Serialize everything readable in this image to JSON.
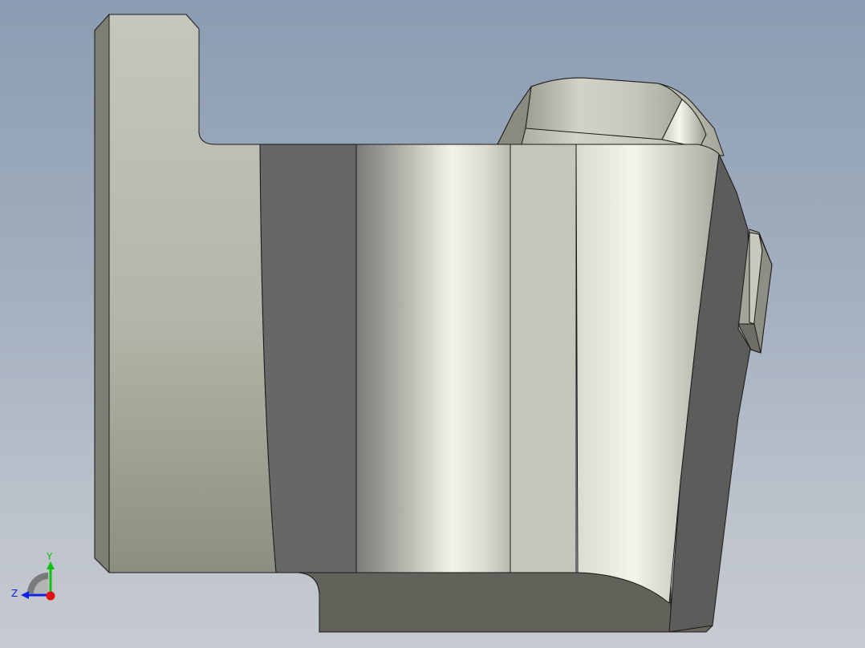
{
  "viewport": {
    "background_top": "#8b9cb2",
    "background_bottom": "#c6cad0",
    "model": "mechanical-part-side-view"
  },
  "triad": {
    "x_axis_color": "#e01010",
    "y_axis_color": "#10c010",
    "z_axis_color": "#1020e0",
    "y_label": "Y",
    "z_label": "Z"
  }
}
